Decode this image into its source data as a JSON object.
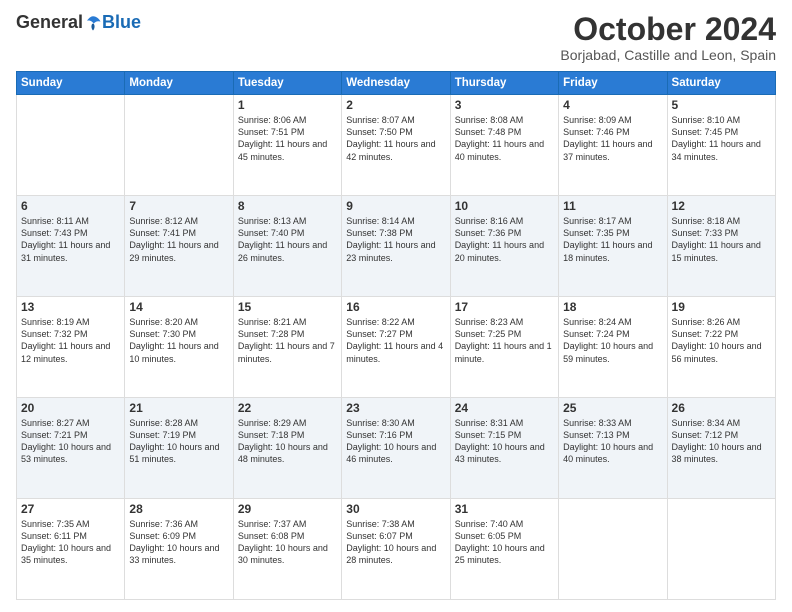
{
  "header": {
    "logo_general": "General",
    "logo_blue": "Blue",
    "month_title": "October 2024",
    "location": "Borjabad, Castille and Leon, Spain"
  },
  "days_of_week": [
    "Sunday",
    "Monday",
    "Tuesday",
    "Wednesday",
    "Thursday",
    "Friday",
    "Saturday"
  ],
  "weeks": [
    [
      {
        "day": "",
        "text": ""
      },
      {
        "day": "",
        "text": ""
      },
      {
        "day": "1",
        "text": "Sunrise: 8:06 AM\nSunset: 7:51 PM\nDaylight: 11 hours and 45 minutes."
      },
      {
        "day": "2",
        "text": "Sunrise: 8:07 AM\nSunset: 7:50 PM\nDaylight: 11 hours and 42 minutes."
      },
      {
        "day": "3",
        "text": "Sunrise: 8:08 AM\nSunset: 7:48 PM\nDaylight: 11 hours and 40 minutes."
      },
      {
        "day": "4",
        "text": "Sunrise: 8:09 AM\nSunset: 7:46 PM\nDaylight: 11 hours and 37 minutes."
      },
      {
        "day": "5",
        "text": "Sunrise: 8:10 AM\nSunset: 7:45 PM\nDaylight: 11 hours and 34 minutes."
      }
    ],
    [
      {
        "day": "6",
        "text": "Sunrise: 8:11 AM\nSunset: 7:43 PM\nDaylight: 11 hours and 31 minutes."
      },
      {
        "day": "7",
        "text": "Sunrise: 8:12 AM\nSunset: 7:41 PM\nDaylight: 11 hours and 29 minutes."
      },
      {
        "day": "8",
        "text": "Sunrise: 8:13 AM\nSunset: 7:40 PM\nDaylight: 11 hours and 26 minutes."
      },
      {
        "day": "9",
        "text": "Sunrise: 8:14 AM\nSunset: 7:38 PM\nDaylight: 11 hours and 23 minutes."
      },
      {
        "day": "10",
        "text": "Sunrise: 8:16 AM\nSunset: 7:36 PM\nDaylight: 11 hours and 20 minutes."
      },
      {
        "day": "11",
        "text": "Sunrise: 8:17 AM\nSunset: 7:35 PM\nDaylight: 11 hours and 18 minutes."
      },
      {
        "day": "12",
        "text": "Sunrise: 8:18 AM\nSunset: 7:33 PM\nDaylight: 11 hours and 15 minutes."
      }
    ],
    [
      {
        "day": "13",
        "text": "Sunrise: 8:19 AM\nSunset: 7:32 PM\nDaylight: 11 hours and 12 minutes."
      },
      {
        "day": "14",
        "text": "Sunrise: 8:20 AM\nSunset: 7:30 PM\nDaylight: 11 hours and 10 minutes."
      },
      {
        "day": "15",
        "text": "Sunrise: 8:21 AM\nSunset: 7:28 PM\nDaylight: 11 hours and 7 minutes."
      },
      {
        "day": "16",
        "text": "Sunrise: 8:22 AM\nSunset: 7:27 PM\nDaylight: 11 hours and 4 minutes."
      },
      {
        "day": "17",
        "text": "Sunrise: 8:23 AM\nSunset: 7:25 PM\nDaylight: 11 hours and 1 minute."
      },
      {
        "day": "18",
        "text": "Sunrise: 8:24 AM\nSunset: 7:24 PM\nDaylight: 10 hours and 59 minutes."
      },
      {
        "day": "19",
        "text": "Sunrise: 8:26 AM\nSunset: 7:22 PM\nDaylight: 10 hours and 56 minutes."
      }
    ],
    [
      {
        "day": "20",
        "text": "Sunrise: 8:27 AM\nSunset: 7:21 PM\nDaylight: 10 hours and 53 minutes."
      },
      {
        "day": "21",
        "text": "Sunrise: 8:28 AM\nSunset: 7:19 PM\nDaylight: 10 hours and 51 minutes."
      },
      {
        "day": "22",
        "text": "Sunrise: 8:29 AM\nSunset: 7:18 PM\nDaylight: 10 hours and 48 minutes."
      },
      {
        "day": "23",
        "text": "Sunrise: 8:30 AM\nSunset: 7:16 PM\nDaylight: 10 hours and 46 minutes."
      },
      {
        "day": "24",
        "text": "Sunrise: 8:31 AM\nSunset: 7:15 PM\nDaylight: 10 hours and 43 minutes."
      },
      {
        "day": "25",
        "text": "Sunrise: 8:33 AM\nSunset: 7:13 PM\nDaylight: 10 hours and 40 minutes."
      },
      {
        "day": "26",
        "text": "Sunrise: 8:34 AM\nSunset: 7:12 PM\nDaylight: 10 hours and 38 minutes."
      }
    ],
    [
      {
        "day": "27",
        "text": "Sunrise: 7:35 AM\nSunset: 6:11 PM\nDaylight: 10 hours and 35 minutes."
      },
      {
        "day": "28",
        "text": "Sunrise: 7:36 AM\nSunset: 6:09 PM\nDaylight: 10 hours and 33 minutes."
      },
      {
        "day": "29",
        "text": "Sunrise: 7:37 AM\nSunset: 6:08 PM\nDaylight: 10 hours and 30 minutes."
      },
      {
        "day": "30",
        "text": "Sunrise: 7:38 AM\nSunset: 6:07 PM\nDaylight: 10 hours and 28 minutes."
      },
      {
        "day": "31",
        "text": "Sunrise: 7:40 AM\nSunset: 6:05 PM\nDaylight: 10 hours and 25 minutes."
      },
      {
        "day": "",
        "text": ""
      },
      {
        "day": "",
        "text": ""
      }
    ]
  ]
}
